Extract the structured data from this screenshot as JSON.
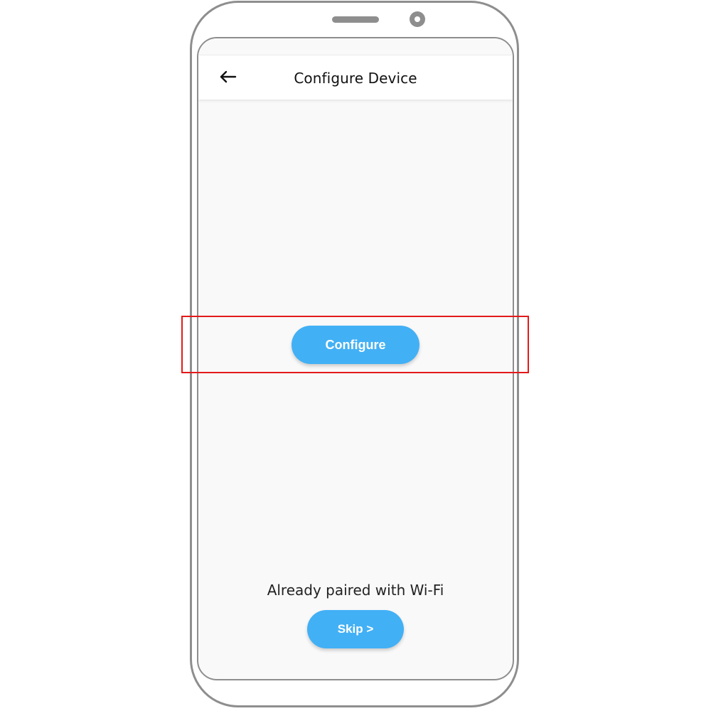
{
  "app_bar": {
    "back_icon": "arrow-left-icon",
    "title": "Configure Device"
  },
  "main": {
    "configure_label": "Configure"
  },
  "footer": {
    "paired_text": "Already paired with Wi-Fi",
    "skip_label": "Skip >"
  },
  "colors": {
    "button": "#42b0f5",
    "highlight": "#e31a1a",
    "device_frame": "#8e8e8e",
    "screen_background": "#f9f9f9"
  }
}
